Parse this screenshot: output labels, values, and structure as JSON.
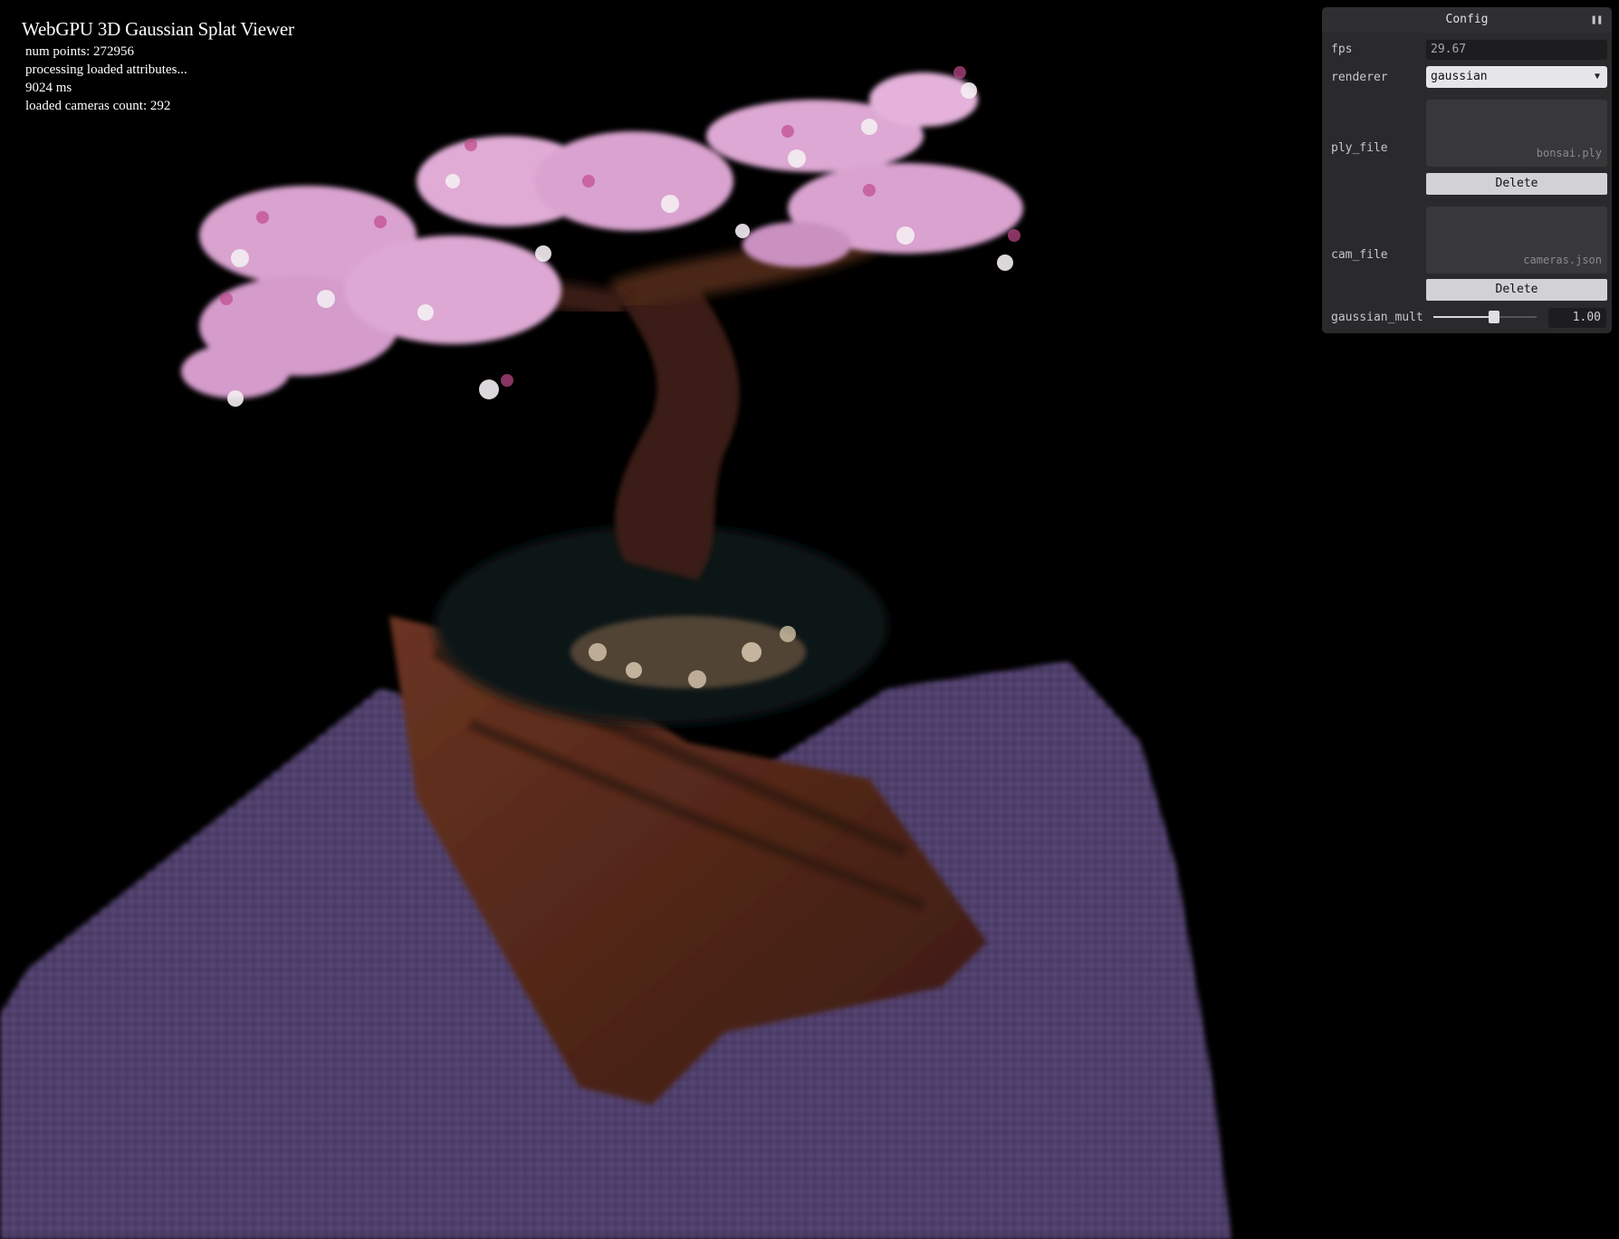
{
  "hud": {
    "title": "WebGPU 3D Gaussian Splat Viewer",
    "lines": [
      "num points: 272956",
      "processing loaded attributes...",
      "9024 ms",
      "loaded cameras count: 292"
    ]
  },
  "config": {
    "title": "Config",
    "collapse_icon": "pause-icon",
    "fps": {
      "label": "fps",
      "value": "29.67"
    },
    "renderer": {
      "label": "renderer",
      "value": "gaussian"
    },
    "ply_file": {
      "label": "ply_file",
      "filename": "bonsai.ply",
      "delete_label": "Delete"
    },
    "cam_file": {
      "label": "cam_file",
      "filename": "cameras.json",
      "delete_label": "Delete"
    },
    "gaussian_mult": {
      "label": "gaussian_mult",
      "value": "1.00",
      "slider_fraction": 0.6
    }
  },
  "colors": {
    "background": "#000000",
    "panel": "#2a2a2c",
    "blossom": "#e8a8d8",
    "trunk": "#5a2e1e",
    "cloth": "#5a4878"
  }
}
